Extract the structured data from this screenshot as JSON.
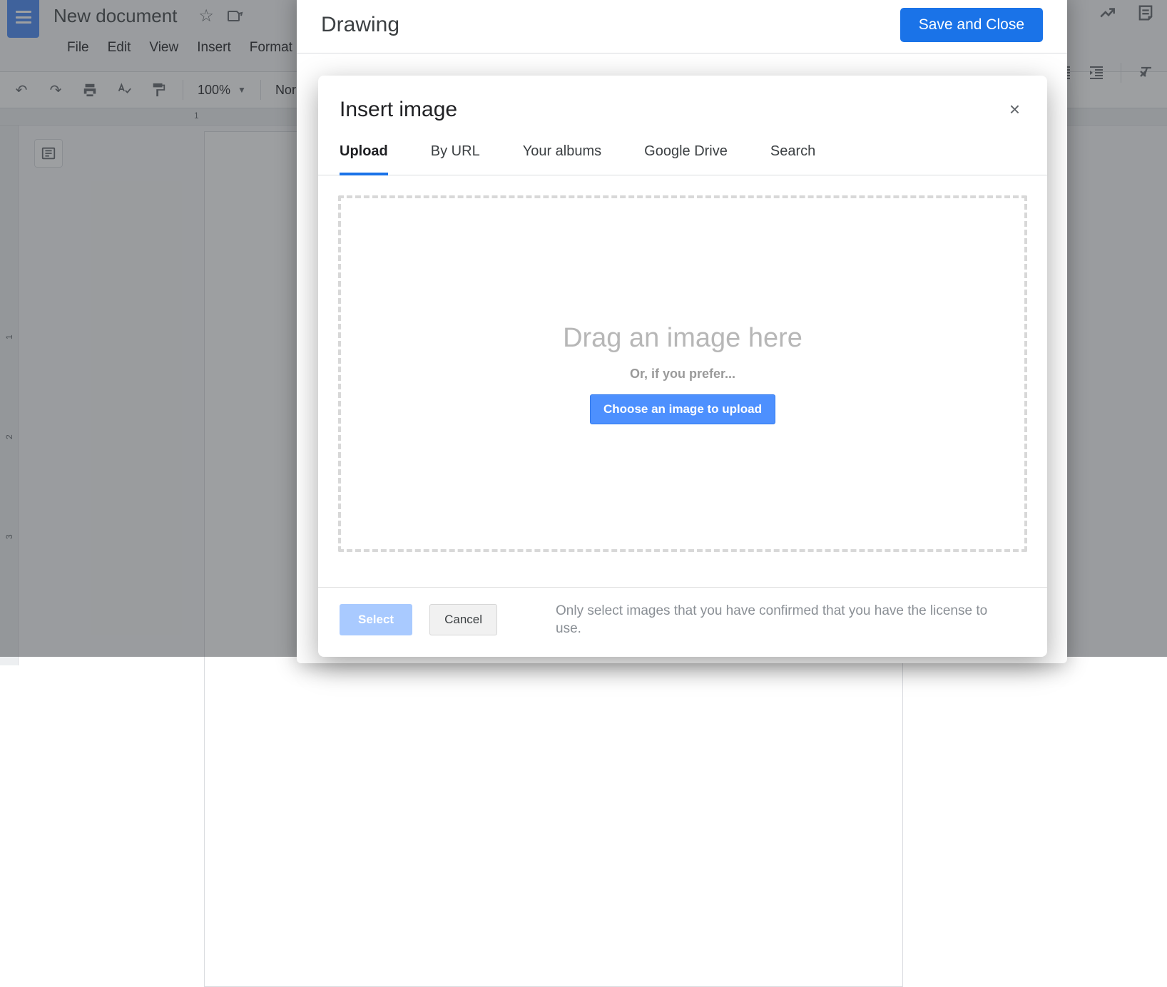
{
  "docs": {
    "title": "New document",
    "menus": [
      "File",
      "Edit",
      "View",
      "Insert",
      "Format"
    ],
    "zoom": "100%",
    "style_dropdown": "Normal",
    "ruler_h": [
      "1"
    ],
    "ruler_v": [
      "1",
      "2",
      "3"
    ]
  },
  "drawing_modal": {
    "title": "Drawing",
    "save_close": "Save and Close"
  },
  "insert_modal": {
    "title": "Insert image",
    "close_glyph": "×",
    "tabs": {
      "upload": "Upload",
      "by_url": "By URL",
      "your_albums": "Your albums",
      "google_drive": "Google Drive",
      "search": "Search"
    },
    "active_tab": "upload",
    "drag_text": "Drag an image here",
    "prefer_text": "Or, if you prefer...",
    "choose_button": "Choose an image to upload",
    "footer": {
      "select": "Select",
      "cancel": "Cancel",
      "license_notice": "Only select images that you have confirmed that you have the license to use."
    }
  }
}
